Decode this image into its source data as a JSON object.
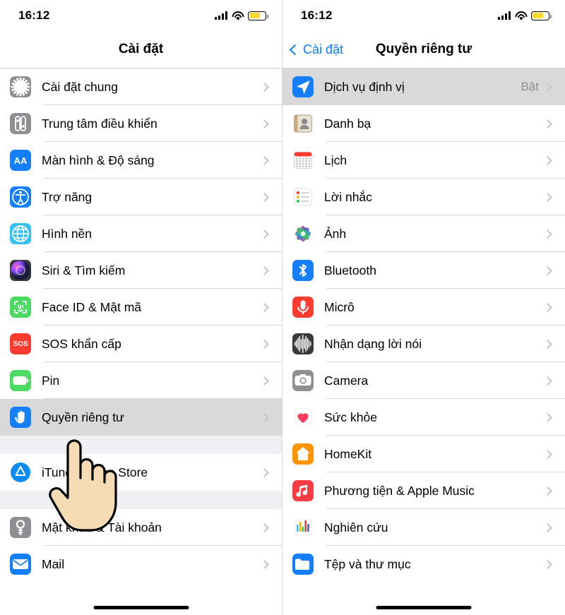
{
  "status": {
    "time": "16:12",
    "battery_level": "70"
  },
  "left": {
    "nav": {
      "title": "Cài đặt"
    },
    "groups": [
      {
        "rows": [
          {
            "label": "Cài đặt chung",
            "icon": "gear-icon",
            "color": "#8e8e93",
            "value": ""
          },
          {
            "label": "Trung tâm điều khiển",
            "icon": "control-center-icon",
            "color": "#8e8e93",
            "value": ""
          },
          {
            "label": "Màn hình & Độ sáng",
            "icon": "display-brightness-icon",
            "color": "#147efb",
            "value": ""
          },
          {
            "label": "Trợ năng",
            "icon": "accessibility-icon",
            "color": "#147efb",
            "value": ""
          },
          {
            "label": "Hình nền",
            "icon": "wallpaper-icon",
            "color": "#35c1f1",
            "value": ""
          },
          {
            "label": "Siri & Tìm kiếm",
            "icon": "siri-icon",
            "color": "#3a3a3c",
            "value": ""
          },
          {
            "label": "Face ID & Mật mã",
            "icon": "face-id-icon",
            "color": "#4cd964",
            "value": ""
          },
          {
            "label": "SOS khẩn cấp",
            "icon": "sos-icon",
            "color": "#ff3b30",
            "value": ""
          },
          {
            "label": "Pin",
            "icon": "battery-icon",
            "color": "#4cd964",
            "value": ""
          },
          {
            "label": "Quyền riêng tư",
            "icon": "privacy-hand-icon",
            "color": "#147efb",
            "value": "",
            "selected": true
          }
        ]
      },
      {
        "rows": [
          {
            "label": "iTunes & App Store",
            "icon": "app-store-icon",
            "color": "#147efb",
            "value": ""
          }
        ]
      },
      {
        "rows": [
          {
            "label": "Mật khẩu & Tài khoản",
            "icon": "passwords-accounts-icon",
            "color": "#8e8e93",
            "value": ""
          },
          {
            "label": "Mail",
            "icon": "mail-icon",
            "color": "#147efb",
            "value": ""
          }
        ]
      }
    ]
  },
  "right": {
    "nav": {
      "back_label": "Cài đặt",
      "title": "Quyền riêng tư"
    },
    "groups": [
      {
        "rows": [
          {
            "label": "Dịch vụ định vị",
            "icon": "location-services-icon",
            "color": "#147efb",
            "value": "Bật",
            "selected": true
          },
          {
            "label": "Danh bạ",
            "icon": "contacts-icon",
            "color": "#c8a97e",
            "value": ""
          },
          {
            "label": "Lịch",
            "icon": "calendar-icon",
            "color": "#ffffff",
            "value": ""
          },
          {
            "label": "Lời nhắc",
            "icon": "reminders-icon",
            "color": "#ffffff",
            "value": ""
          },
          {
            "label": "Ảnh",
            "icon": "photos-icon",
            "color": "#ffffff",
            "value": ""
          },
          {
            "label": "Bluetooth",
            "icon": "bluetooth-icon",
            "color": "#147efb",
            "value": ""
          },
          {
            "label": "Micrô",
            "icon": "microphone-icon",
            "color": "#ff3b30",
            "value": ""
          },
          {
            "label": "Nhận dạng lời nói",
            "icon": "speech-recognition-icon",
            "color": "#3a3a3c",
            "value": ""
          },
          {
            "label": "Camera",
            "icon": "camera-icon",
            "color": "#8e8e93",
            "value": ""
          },
          {
            "label": "Sức khỏe",
            "icon": "health-icon",
            "color": "#ffffff",
            "value": ""
          },
          {
            "label": "HomeKit",
            "icon": "homekit-icon",
            "color": "#ff9500",
            "value": ""
          },
          {
            "label": "Phương tiện & Apple Music",
            "icon": "apple-music-icon",
            "color": "#fc3c44",
            "value": ""
          },
          {
            "label": "Nghiên cứu",
            "icon": "research-icon",
            "color": "#ffffff",
            "value": ""
          },
          {
            "label": "Tệp và thư mục",
            "icon": "files-folders-icon",
            "color": "#147efb",
            "value": ""
          }
        ]
      }
    ]
  }
}
